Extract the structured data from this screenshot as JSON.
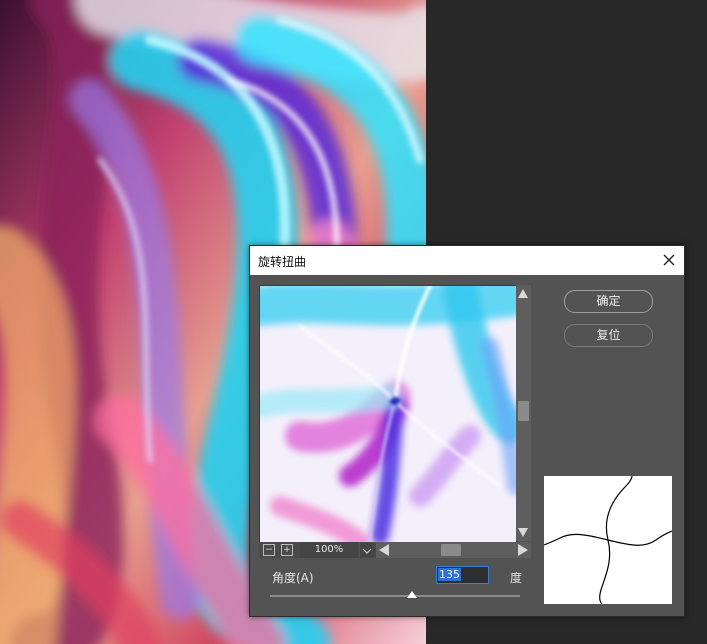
{
  "dialog": {
    "title": "旋转扭曲",
    "ok_label": "确定",
    "reset_label": "复位",
    "zoom": "100%",
    "angle_label": "角度(A)",
    "angle_value": "135",
    "angle_unit": "度",
    "angle_slider_fraction": 0.56
  },
  "icons": {
    "close": "close-icon",
    "zoom_out": "zoom-out-icon",
    "zoom_in": "zoom-in-icon",
    "dropdown": "chevron-down-icon",
    "scroll_up": "arrow-up-icon",
    "scroll_down": "arrow-down-icon",
    "scroll_left": "arrow-left-icon",
    "scroll_right": "arrow-right-icon"
  },
  "colors": {
    "workspace": "#262626",
    "dialog_bg": "#535353",
    "selection": "#2f6fd6",
    "input_border": "#3d7bd9"
  }
}
